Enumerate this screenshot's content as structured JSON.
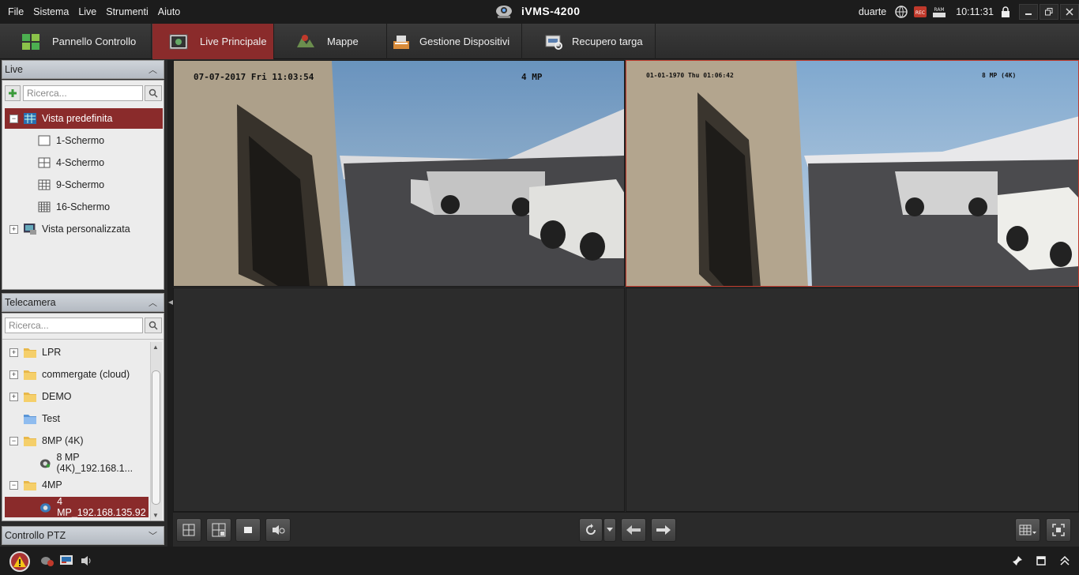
{
  "menu": [
    "File",
    "Sistema",
    "Live",
    "Strumenti",
    "Aiuto"
  ],
  "app_title": "iVMS-4200",
  "status": {
    "user": "duarte",
    "time": "10:11:31",
    "ram_label": "RAM",
    "rec_label": "REC"
  },
  "tabs": [
    {
      "label": "Pannello Controllo",
      "icon": "grid-icon"
    },
    {
      "label": "Live Principale",
      "icon": "live-view-icon"
    },
    {
      "label": "Mappe",
      "icon": "map-icon"
    },
    {
      "label": "Gestione Dispositivi",
      "icon": "device-icon"
    },
    {
      "label": "Recupero targa",
      "icon": "plate-search-icon"
    }
  ],
  "live_panel": {
    "title": "Live",
    "search_placeholder": "Ricerca...",
    "items": [
      {
        "label": "Vista predefinita",
        "selected": true
      },
      {
        "label": "1-Schermo"
      },
      {
        "label": "4-Schermo"
      },
      {
        "label": "9-Schermo"
      },
      {
        "label": "16-Schermo"
      },
      {
        "label": "Vista personalizzata"
      }
    ]
  },
  "camera_panel": {
    "title": "Telecamera",
    "search_placeholder": "Ricerca...",
    "items": [
      {
        "label": "LPR",
        "type": "folder",
        "expander": "+"
      },
      {
        "label": "commergate (cloud)",
        "type": "folder",
        "expander": "+"
      },
      {
        "label": "DEMO",
        "type": "folder",
        "expander": "+"
      },
      {
        "label": "Test",
        "type": "folder-blue",
        "expander": ""
      },
      {
        "label": "8MP (4K)",
        "type": "folder",
        "expander": "−"
      },
      {
        "label": "8 MP (4K)_192.168.1...",
        "type": "camera",
        "expander": ""
      },
      {
        "label": "4MP",
        "type": "folder",
        "expander": "−"
      },
      {
        "label": "4 MP_192.168.135.92",
        "type": "camera",
        "expander": "",
        "selected": true
      }
    ]
  },
  "ptz_panel": {
    "title": "Controllo PTZ"
  },
  "video": {
    "cell1": {
      "timestamp": "07-07-2017 Fri 11:03:54",
      "label": "4 MP"
    },
    "cell2": {
      "timestamp": "01-01-1970 Thu 01:06:42",
      "label": "8 MP (4K)"
    }
  },
  "colors": {
    "accent": "#8a2b2b",
    "selected_border": "#c0392b",
    "panel_header": "#c4c9d0"
  }
}
